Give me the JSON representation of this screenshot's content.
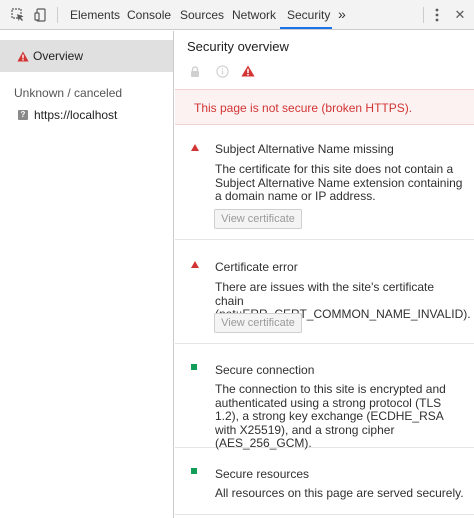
{
  "toolbar": {
    "inspect_icon": "inspect-element-icon",
    "device_icon": "device-toolbar-icon",
    "tabs": [
      {
        "label": "Elements"
      },
      {
        "label": "Console"
      },
      {
        "label": "Sources"
      },
      {
        "label": "Network"
      },
      {
        "label": "Security"
      }
    ],
    "active_tab": "Security",
    "overflow_label": "»",
    "menu_icon": "kebab-menu-icon",
    "close_label": "✕"
  },
  "sidebar": {
    "overview_label": "Overview",
    "overview_icon": "warning-icon",
    "group_title": "Unknown / canceled",
    "origin_label": "https://localhost",
    "origin_badge": "?"
  },
  "main": {
    "title": "Security overview",
    "summary_text": "This page is not secure (broken HTTPS).",
    "explanations": [
      {
        "status": "insecure",
        "title": "Subject Alternative Name missing",
        "description": "The certificate for this site does not contain a Subject Alternative Name extension containing a domain name or IP address.",
        "button": "View certificate"
      },
      {
        "status": "insecure",
        "title": "Certificate error",
        "description": "There are issues with the site's certificate chain (net::ERR_CERT_COMMON_NAME_INVALID).",
        "button": "View certificate"
      },
      {
        "status": "secure",
        "title": "Secure connection",
        "description": "The connection to this site is encrypted and authenticated using a strong protocol (TLS 1.2), a strong key exchange (ECDHE_RSA with X25519), and a strong cipher (AES_256_GCM)."
      },
      {
        "status": "secure",
        "title": "Secure resources",
        "description": "All resources on this page are served securely."
      }
    ]
  },
  "colors": {
    "insecure": "#d23434",
    "secure": "#0f9d58",
    "active_tab_underline": "#1a73e8"
  }
}
